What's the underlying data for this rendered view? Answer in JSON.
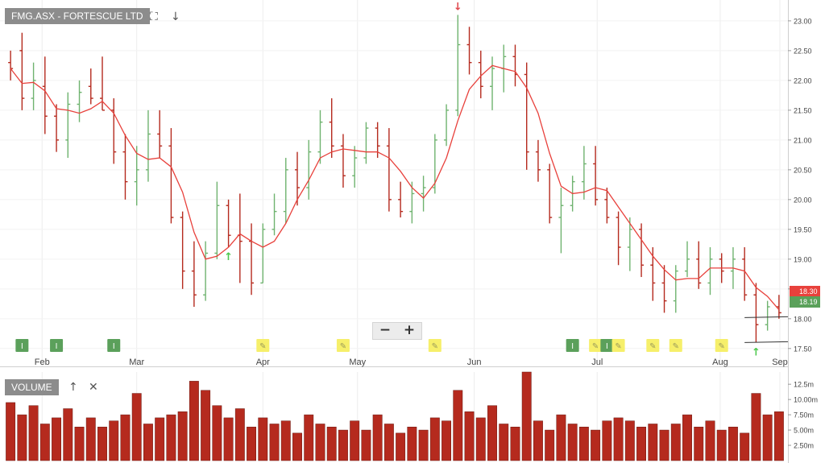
{
  "header": {
    "symbol_label": "FMG.ASX - FORTESCUE LTD",
    "expand_icon": "expand-icon",
    "download_icon": "arrow-down-icon"
  },
  "volume_panel": {
    "label": "VOLUME",
    "move_up_icon": "arrow-up-icon",
    "close_icon": "close-icon"
  },
  "zoom": {
    "minus": "−",
    "plus": "+"
  },
  "colors": {
    "up": "#6fb36f",
    "down": "#b52a1e",
    "ma": "#e8413c",
    "vol": "#b52a1e",
    "signal_up": "#4cc84c",
    "signal_down": "#e0474c",
    "tag_current": "#e8413c",
    "tag_ma": "#5aa15a"
  },
  "chart_data": {
    "type": "ohlc",
    "price_axis": {
      "ticks": [
        "17.50",
        "18.00",
        "18.50",
        "19.00",
        "19.50",
        "20.00",
        "20.50",
        "21.00",
        "21.50",
        "22.00",
        "22.50",
        "23.00"
      ],
      "ylim": [
        17.2,
        23.35
      ]
    },
    "volume_axis": {
      "ticks": [
        "2.50m",
        "5.00m",
        "7.50m",
        "10.00m",
        "12.5m"
      ],
      "ylim": [
        0,
        14.5
      ]
    },
    "months": [
      "Feb",
      "Mar",
      "Apr",
      "May",
      "Jun",
      "Jul",
      "Aug",
      "Sep"
    ],
    "month_positions": [
      1.0,
      4.0,
      8.0,
      11.0,
      14.7,
      18.6,
      22.5,
      25.6
    ],
    "ticker_current": "18.30",
    "ma_value": "18.19",
    "ohlc": [
      [
        22.3,
        22.5,
        22.0,
        22.2
      ],
      [
        22.5,
        22.8,
        21.5,
        21.7
      ],
      [
        21.7,
        22.3,
        21.5,
        22.0
      ],
      [
        21.9,
        22.4,
        21.1,
        21.4
      ],
      [
        21.4,
        21.6,
        20.8,
        21.0
      ],
      [
        21.0,
        21.8,
        20.7,
        21.6
      ],
      [
        21.6,
        22.0,
        21.3,
        21.8
      ],
      [
        21.9,
        22.2,
        21.6,
        21.7
      ],
      [
        21.7,
        22.4,
        21.5,
        21.5
      ],
      [
        21.5,
        21.7,
        20.6,
        20.8
      ],
      [
        20.8,
        21.1,
        20.0,
        20.3
      ],
      [
        20.3,
        20.9,
        19.9,
        20.5
      ],
      [
        20.5,
        21.5,
        20.3,
        21.1
      ],
      [
        21.1,
        21.5,
        20.7,
        20.9
      ],
      [
        20.9,
        21.2,
        19.6,
        19.7
      ],
      [
        19.7,
        19.8,
        18.5,
        18.8
      ],
      [
        18.8,
        19.3,
        18.2,
        18.4
      ],
      [
        18.4,
        19.3,
        18.3,
        19.1
      ],
      [
        19.1,
        20.3,
        19.0,
        19.9
      ],
      [
        19.9,
        20.0,
        19.2,
        19.4
      ],
      [
        19.4,
        20.1,
        18.6,
        19.3
      ],
      [
        19.3,
        19.6,
        18.4,
        18.6
      ],
      [
        18.6,
        19.6,
        18.6,
        19.5
      ],
      [
        19.5,
        20.1,
        19.4,
        19.8
      ],
      [
        19.8,
        20.7,
        19.6,
        20.5
      ],
      [
        20.5,
        20.8,
        19.9,
        20.2
      ],
      [
        20.2,
        21.0,
        20.0,
        20.8
      ],
      [
        20.8,
        21.5,
        20.6,
        21.3
      ],
      [
        21.3,
        21.7,
        20.7,
        20.9
      ],
      [
        20.9,
        21.1,
        20.2,
        20.4
      ],
      [
        20.4,
        20.9,
        20.2,
        20.7
      ],
      [
        20.7,
        21.3,
        20.6,
        21.2
      ],
      [
        21.2,
        21.3,
        20.7,
        20.9
      ],
      [
        20.9,
        21.2,
        19.8,
        20.0
      ],
      [
        20.0,
        20.3,
        19.7,
        19.8
      ],
      [
        19.8,
        20.3,
        19.6,
        20.1
      ],
      [
        20.1,
        20.4,
        19.8,
        20.2
      ],
      [
        20.2,
        21.1,
        20.1,
        21.0
      ],
      [
        21.0,
        21.6,
        20.9,
        21.5
      ],
      [
        21.5,
        23.1,
        21.4,
        22.6
      ],
      [
        22.6,
        22.9,
        22.1,
        22.3
      ],
      [
        22.3,
        22.5,
        21.7,
        21.9
      ],
      [
        21.9,
        22.4,
        21.5,
        22.2
      ],
      [
        22.2,
        22.6,
        21.8,
        22.4
      ],
      [
        22.4,
        22.6,
        21.9,
        22.1
      ],
      [
        22.1,
        22.3,
        20.5,
        20.8
      ],
      [
        20.8,
        21.0,
        20.3,
        20.5
      ],
      [
        20.5,
        20.6,
        19.6,
        19.7
      ],
      [
        19.7,
        20.2,
        19.1,
        19.9
      ],
      [
        19.9,
        20.4,
        19.8,
        20.3
      ],
      [
        20.3,
        20.9,
        20.0,
        20.6
      ],
      [
        20.6,
        20.9,
        19.9,
        20.0
      ],
      [
        20.0,
        20.2,
        19.6,
        19.7
      ],
      [
        19.7,
        19.8,
        18.9,
        19.2
      ],
      [
        19.2,
        19.7,
        18.8,
        19.5
      ],
      [
        19.5,
        19.6,
        18.7,
        18.9
      ],
      [
        18.9,
        19.2,
        18.3,
        18.6
      ],
      [
        18.6,
        18.9,
        18.1,
        18.3
      ],
      [
        18.3,
        18.9,
        18.1,
        18.8
      ],
      [
        18.8,
        19.3,
        18.7,
        19.0
      ],
      [
        19.0,
        19.3,
        18.5,
        18.6
      ],
      [
        18.6,
        19.2,
        18.4,
        19.0
      ],
      [
        19.0,
        19.1,
        18.6,
        18.8
      ],
      [
        18.8,
        19.2,
        18.5,
        19.0
      ],
      [
        19.0,
        19.2,
        18.3,
        18.4
      ],
      [
        18.4,
        18.6,
        17.6,
        17.9
      ],
      [
        17.9,
        18.3,
        17.8,
        18.2
      ],
      [
        18.2,
        18.4,
        18.0,
        18.1
      ]
    ],
    "volume": [
      9.5,
      7.5,
      9.0,
      6.0,
      7.0,
      8.5,
      5.5,
      7.0,
      5.5,
      6.5,
      7.5,
      11.0,
      6.0,
      7.0,
      7.5,
      8.0,
      13.0,
      11.5,
      9.0,
      7.0,
      8.5,
      5.5,
      7.0,
      6.0,
      6.5,
      4.5,
      7.5,
      6.0,
      5.5,
      5.0,
      6.5,
      5.0,
      7.5,
      6.0,
      4.5,
      5.5,
      5.0,
      7.0,
      6.5,
      11.5,
      8.0,
      7.0,
      9.0,
      6.0,
      5.5,
      14.5,
      6.5,
      5.0,
      7.5,
      6.0,
      5.5,
      5.0,
      6.5,
      7.0,
      6.5,
      5.5,
      6.0,
      5.0,
      6.0,
      7.5,
      5.5,
      6.5,
      5.0,
      5.5,
      4.5,
      11.0,
      7.5,
      8.0
    ],
    "signals_up": [
      19,
      65
    ],
    "signals_down": [
      39
    ],
    "support_lines": [
      17.6,
      18.02
    ]
  }
}
